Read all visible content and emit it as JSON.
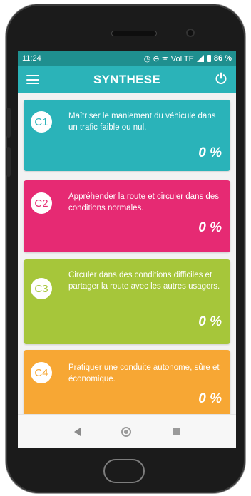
{
  "status_bar": {
    "time": "11:24",
    "icons_text": "◷ ⊖ ᯤ VoLTE",
    "battery": "86 %"
  },
  "app_bar": {
    "title": "SYNTHESE",
    "menu_icon": "hamburger-menu-icon",
    "power_icon": "power-icon"
  },
  "cards": [
    {
      "code": "C1",
      "text": "Maîtriser le maniement du véhicule dans un trafic faible ou nul.",
      "percent": "0 %",
      "color": "#2ab3b9"
    },
    {
      "code": "C2",
      "text": "Appréhender la route et circuler dans des conditions normales.",
      "percent": "0 %",
      "color": "#e62a73"
    },
    {
      "code": "C3",
      "text": "Circuler dans des conditions difficiles et partager la route avec les autres usagers.",
      "percent": "0 %",
      "color": "#a6c63a"
    },
    {
      "code": "C4",
      "text": "Pratiquer une conduite autonome, sûre et économique.",
      "percent": "0 %",
      "color": "#f7a734"
    }
  ],
  "nav_bar": {
    "back": "back-icon",
    "home": "home-icon",
    "recent": "recent-apps-icon"
  }
}
